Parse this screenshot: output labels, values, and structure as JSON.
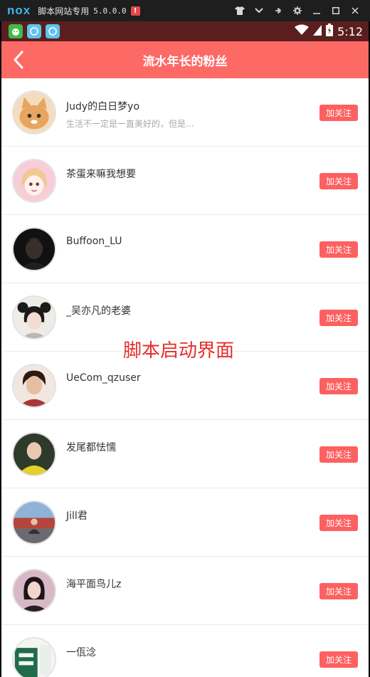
{
  "emulator": {
    "logo": "nox",
    "title": "脚本网站专用",
    "version": "5.0.0.0",
    "alert": "!"
  },
  "status_bar": {
    "time": "5:12"
  },
  "header": {
    "title": "流水年长的粉丝"
  },
  "overlay": {
    "text": "脚本启动界面"
  },
  "followers": [
    {
      "name": "Judy的白日梦yo",
      "bio": "生活不一定是一直美好的，但是...",
      "button": "加关注",
      "avatar_color": "#f2c9a0"
    },
    {
      "name": "茶蛋来嘛我想要",
      "bio": "",
      "button": "加关注",
      "avatar_color": "#f6c6d2"
    },
    {
      "name": "Buffoon_LU",
      "bio": "",
      "button": "加关注",
      "avatar_color": "#1c1c1c"
    },
    {
      "name": "_吴亦凡的老婆",
      "bio": "",
      "button": "加关注",
      "avatar_color": "#d9d2cc"
    },
    {
      "name": "UeCom_qzuser",
      "bio": "",
      "button": "加关注",
      "avatar_color": "#b85050"
    },
    {
      "name": "发尾都怯懦",
      "bio": "",
      "button": "加关注",
      "avatar_color": "#2a2a2a"
    },
    {
      "name": "Jill君",
      "bio": "",
      "button": "加关注",
      "avatar_color": "#7aa0c8"
    },
    {
      "name": "海平面鸟儿z",
      "bio": "",
      "button": "加关注",
      "avatar_color": "#c9a3b3"
    },
    {
      "name": "一佤淰",
      "bio": "",
      "button": "加关注",
      "avatar_color": "#1f6b4a"
    }
  ]
}
